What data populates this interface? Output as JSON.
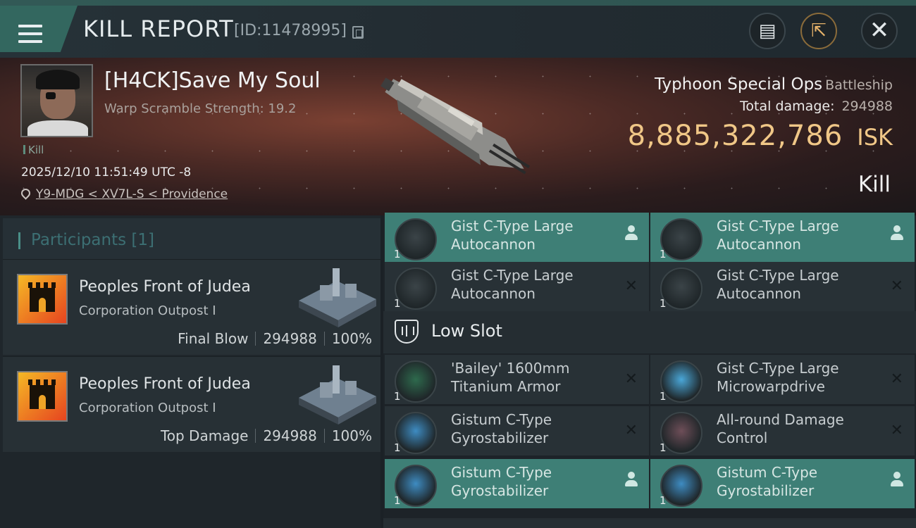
{
  "topbar": {
    "title": "KILL REPORT",
    "report_id": "[ID:11478995]"
  },
  "victim": {
    "name": "[H4CK]Save My Soul",
    "warp_scramble": "Warp Scramble Strength: 19.2",
    "kill_tag": "Kill",
    "datetime": "2025/12/10 11:51:49 UTC -8",
    "location": "Y9-MDG < XV7L-S < Providence",
    "ship_name": "Typhoon Special Ops",
    "ship_class": "Battleship",
    "total_damage_label": "Total damage:",
    "total_damage": "294988",
    "isk_value": "8,885,322,786",
    "isk_unit": "ISK",
    "result": "Kill"
  },
  "participants": {
    "title": "Participants [1]",
    "rows": [
      {
        "corp": "Peoples Front of Judea",
        "ship": "Corporation Outpost I",
        "role": "Final Blow",
        "damage": "294988",
        "percent": "100%"
      },
      {
        "corp": "Peoples Front of Judea",
        "ship": "Corporation Outpost I",
        "role": "Top Damage",
        "damage": "294988",
        "percent": "100%"
      }
    ]
  },
  "fitting": {
    "items_top": [
      {
        "name": "Gist C-Type Large Autocannon",
        "qty": "1",
        "status": "dropped"
      },
      {
        "name": "Gist C-Type Large Autocannon",
        "qty": "1",
        "status": "dropped"
      },
      {
        "name": "Gist C-Type Large Autocannon",
        "qty": "1",
        "status": "destroyed",
        "status_glyph": "✕"
      },
      {
        "name": "Gist C-Type Large Autocannon",
        "qty": "1",
        "status": "destroyed",
        "status_glyph": "✕"
      }
    ],
    "low_slot_label": "Low Slot",
    "items_low": [
      {
        "name": "'Bailey' 1600mm Titanium Armor",
        "qty": "1",
        "status": "destroyed",
        "status_glyph": "✕"
      },
      {
        "name": "Gist C-Type Large Microwarpdrive",
        "qty": "1",
        "status": "destroyed",
        "status_glyph": "✕"
      },
      {
        "name": "Gistum C-Type Gyrostabilizer",
        "qty": "1",
        "status": "destroyed",
        "status_glyph": "✕"
      },
      {
        "name": "All-round Damage Control",
        "qty": "1",
        "status": "destroyed",
        "status_glyph": "✕"
      },
      {
        "name": "Gistum C-Type Gyrostabilizer",
        "qty": "1",
        "status": "dropped"
      },
      {
        "name": "Gistum C-Type Gyrostabilizer",
        "qty": "1",
        "status": "dropped"
      }
    ]
  },
  "colors": {
    "isk": "#f0c787",
    "dropped_highlight": "#3e7f76",
    "accent": "#4a8f88"
  },
  "icons": {
    "menu": "hamburger-icon",
    "copy": "copy-icon",
    "clipboard": "clipboard-icon",
    "share": "share-icon",
    "close": "close-icon",
    "location": "location-pin-icon",
    "slot": "low-slot-icon"
  }
}
